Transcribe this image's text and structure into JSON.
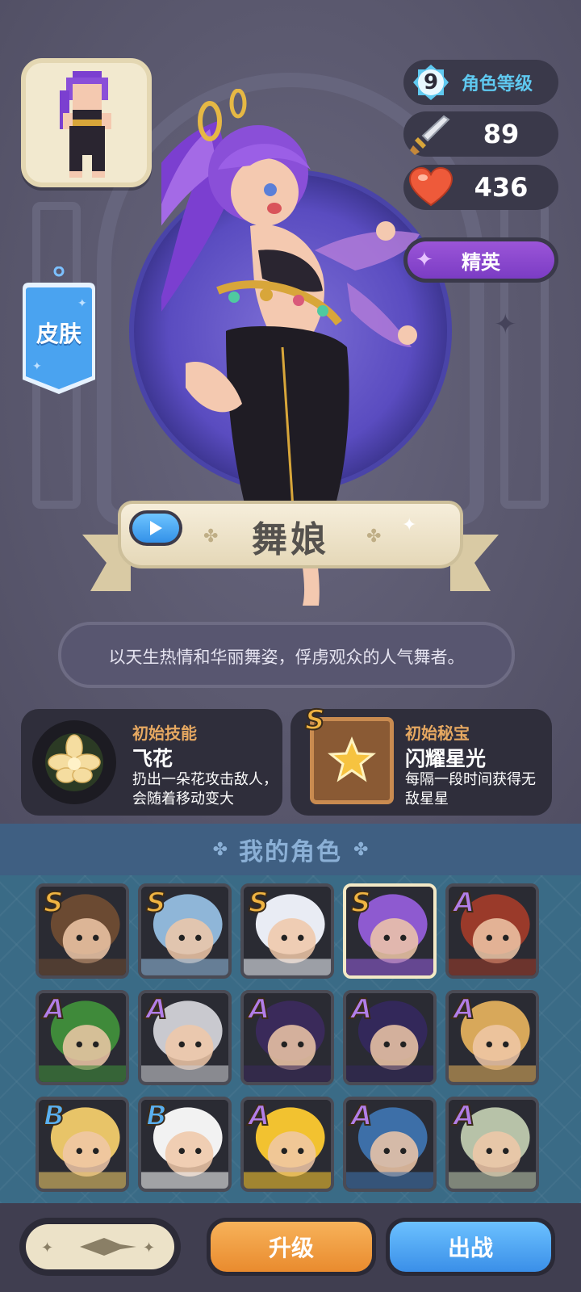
{
  "character": {
    "name": "舞娘",
    "description": "以天生热情和华丽舞姿，俘虏观众的人气舞者。",
    "skin_label": "皮肤"
  },
  "stats": {
    "level": "9",
    "level_label": "角色等级",
    "attack": "89",
    "hp": "436",
    "rank": "精英"
  },
  "skill": {
    "title": "初始技能",
    "name": "飞花",
    "description": "扔出一朵花攻击敌人，会随着移动变大"
  },
  "treasure": {
    "grade": "S",
    "title": "初始秘宝",
    "name": "闪耀星光",
    "description": "每隔一段时间获得无敌星星"
  },
  "roster": {
    "title": "我的角色",
    "characters": [
      {
        "grade": "S",
        "icon": "bearded-hat-hero-icon",
        "color": "#6b4a32"
      },
      {
        "grade": "S",
        "icon": "ice-maiden-icon",
        "color": "#8fb6d8"
      },
      {
        "grade": "S",
        "icon": "robot-knight-icon",
        "color": "#e9ecf4"
      },
      {
        "grade": "S",
        "icon": "dancer-icon",
        "color": "#8e5ad0",
        "selected": true
      },
      {
        "grade": "A",
        "icon": "redhead-brawler-icon",
        "color": "#9a3a2a"
      },
      {
        "grade": "A",
        "icon": "frog-icon",
        "color": "#3f8a3a"
      },
      {
        "grade": "A",
        "icon": "monster-jaw-icon",
        "color": "#c9c9cf"
      },
      {
        "grade": "A",
        "icon": "witch-hat-icon",
        "color": "#3a2a5a"
      },
      {
        "grade": "A",
        "icon": "dark-elf-icon",
        "color": "#33285a"
      },
      {
        "grade": "A",
        "icon": "blonde-girl-icon",
        "color": "#d8a85a"
      },
      {
        "grade": "B",
        "icon": "blonde-boy-icon",
        "color": "#e8c468"
      },
      {
        "grade": "B",
        "icon": "snowman-icon",
        "color": "#f2f2f2"
      },
      {
        "grade": "A",
        "icon": "duck-mustache-icon",
        "color": "#f2c230"
      },
      {
        "grade": "A",
        "icon": "blue-hair-warrior-icon",
        "color": "#3d6fa8"
      },
      {
        "grade": "A",
        "icon": "green-hair-girl-icon",
        "color": "#b7c2a8"
      }
    ]
  },
  "buttons": {
    "upgrade": "升级",
    "deploy": "出战"
  },
  "colors": {
    "accent_blue": "#3a8fe8",
    "accent_orange": "#e98b2e",
    "rank_purple": "#7b3cc4"
  }
}
